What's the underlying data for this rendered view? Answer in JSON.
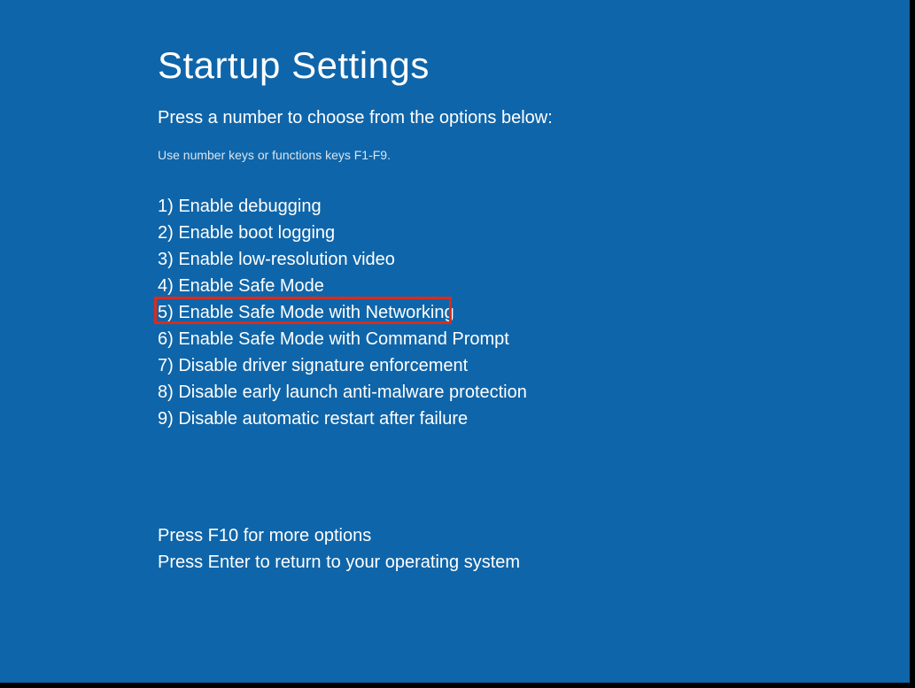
{
  "title": "Startup Settings",
  "instruction": "Press a number to choose from the options below:",
  "hint": "Use number keys or functions keys F1-F9.",
  "options": [
    "1) Enable debugging",
    "2) Enable boot logging",
    "3) Enable low-resolution video",
    "4) Enable Safe Mode",
    "5) Enable Safe Mode with Networking",
    "6) Enable Safe Mode with Command Prompt",
    "7) Disable driver signature enforcement",
    "8) Disable early launch anti-malware protection",
    "9) Disable automatic restart after failure"
  ],
  "footer": {
    "line1": "Press F10 for more options",
    "line2": "Press Enter to return to your operating system"
  },
  "highlighted_index": 4
}
